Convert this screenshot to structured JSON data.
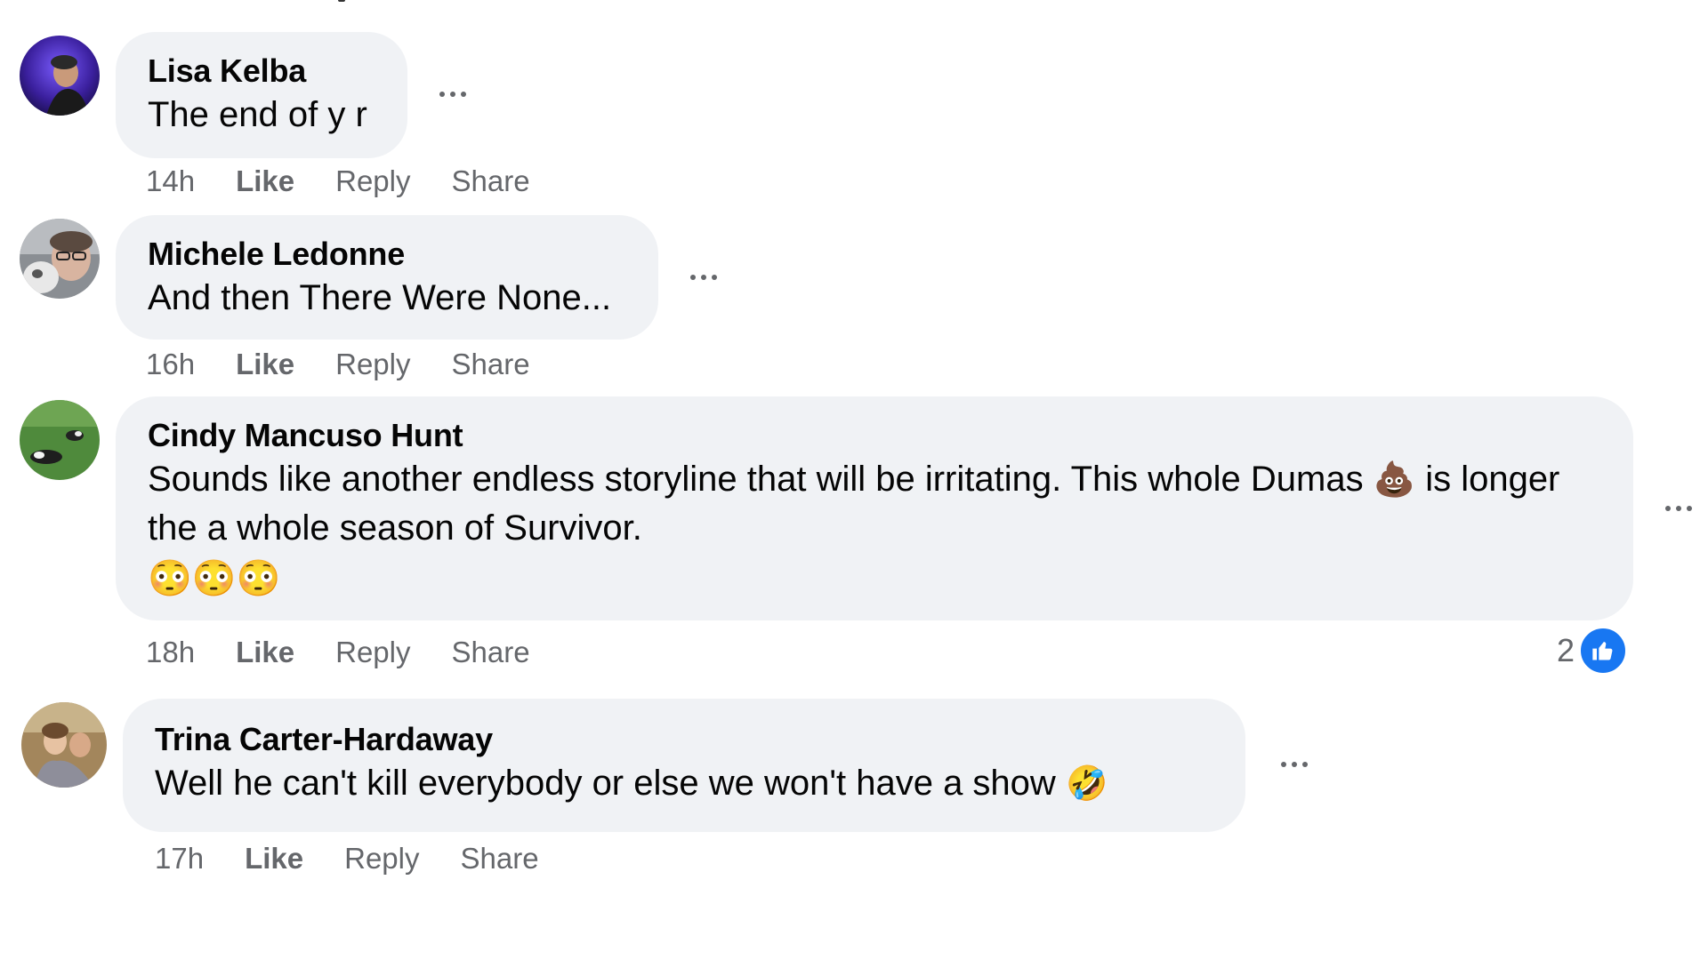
{
  "comments": [
    {
      "author": "Lisa Kelba",
      "text": "The end of y r",
      "time": "14h",
      "like_label": "Like",
      "reply_label": "Reply",
      "share_label": "Share"
    },
    {
      "author": "Michele Ledonne",
      "text": "And then There Were None...",
      "time": "16h",
      "like_label": "Like",
      "reply_label": "Reply",
      "share_label": "Share"
    },
    {
      "author": "Cindy Mancuso Hunt",
      "text_part1": "Sounds like another endless storyline that will be irritating. This whole Dumas",
      "emoji_inline": "💩",
      "text_part2": "is longer the a whole season of Survivor.",
      "emoji_row": "😳😳😳",
      "time": "18h",
      "like_label": "Like",
      "reply_label": "Reply",
      "share_label": "Share",
      "reaction_count": "2"
    },
    {
      "author": "Trina Carter-Hardaway",
      "text": "Well he can't kill everybody or else we won't have a show",
      "emoji_inline": "🤣",
      "time": "17h",
      "like_label": "Like",
      "reply_label": "Reply",
      "share_label": "Share"
    }
  ],
  "icons": {
    "more": "more-options-icon",
    "like_reaction": "thumbs-up-icon"
  },
  "colors": {
    "bubble": "#f0f2f5",
    "meta": "#65676b",
    "like_blue": "#1877f2"
  }
}
